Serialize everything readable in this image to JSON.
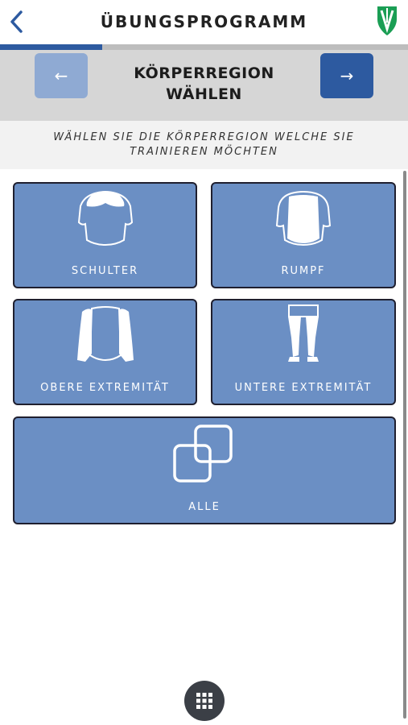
{
  "header": {
    "title": "ÜBUNGSPROGRAMM",
    "back_icon": "chevron-left-icon",
    "logo_icon": "brand-logo-icon"
  },
  "progress": {
    "value": 0.25,
    "fill_color": "#2d5aa0"
  },
  "step": {
    "title_line1": "KÖRPERREGION",
    "title_line2": "WÄHLEN",
    "prev_icon": "arrow-left-icon",
    "next_icon": "arrow-right-icon"
  },
  "instruction": "WÄHLEN SIE DIE KÖRPERREGION WELCHE SIE TRAINIEREN MÖCHTEN",
  "regions": [
    {
      "label": "SCHULTER",
      "icon": "shoulder-icon"
    },
    {
      "label": "RUMPF",
      "icon": "torso-icon"
    },
    {
      "label": "OBERE EXTREMITÄT",
      "icon": "upper-limbs-icon"
    },
    {
      "label": "UNTERE EXTREMITÄT",
      "icon": "lower-limbs-icon"
    },
    {
      "label": "ALLE",
      "icon": "overlapping-squares-icon"
    }
  ],
  "colors": {
    "tile": "#6b8fc4",
    "accent": "#2d5aa0",
    "logo": "#1a9e54"
  },
  "bottom_button_icon": "grid-menu-icon"
}
